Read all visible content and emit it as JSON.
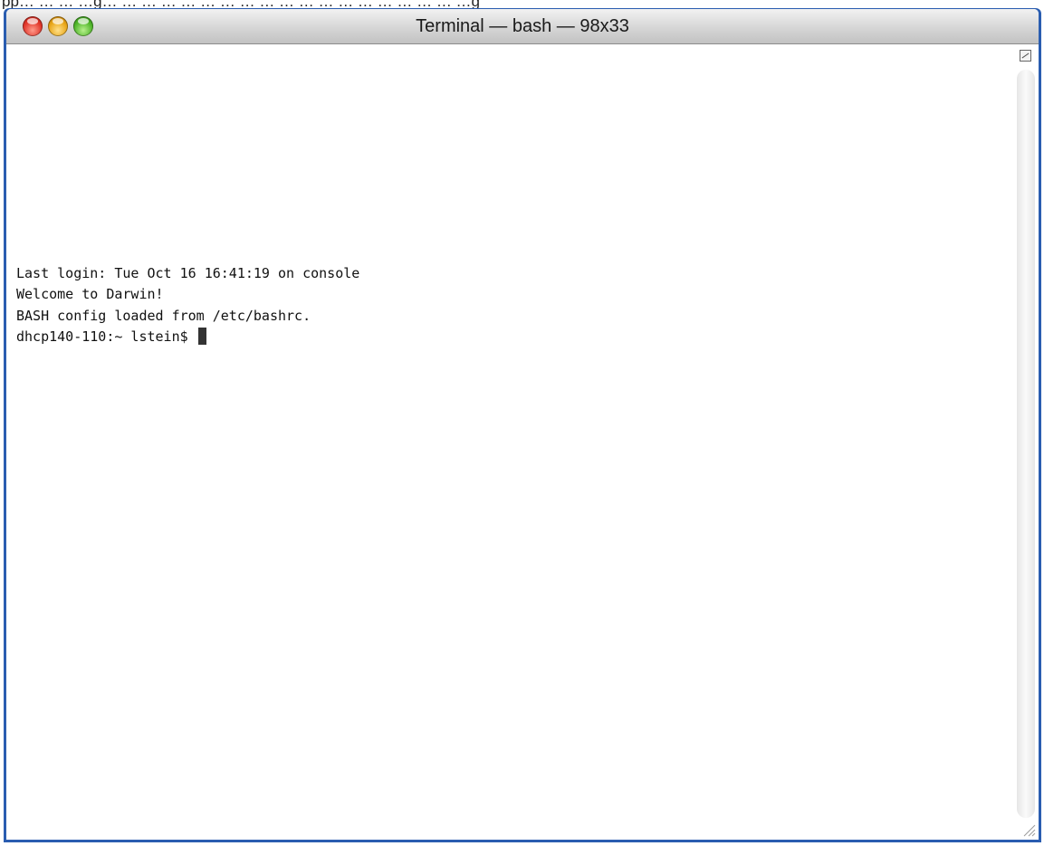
{
  "caption": "pp… … … …g… … … … … … … … … … … … … … … … … … …g",
  "window": {
    "title": "Terminal — bash — 98x33",
    "controls": {
      "close": "close-icon",
      "minimize": "minimize-icon",
      "zoom": "zoom-icon"
    }
  },
  "terminal": {
    "lines": [
      "Last login: Tue Oct 16 16:41:19 on console",
      "Welcome to Darwin!",
      "BASH config loaded from /etc/bashrc."
    ],
    "prompt": "dhcp140-110:~ lstein$ "
  },
  "colors": {
    "window_border": "#2a5db0",
    "titlebar": "#d6d6d6",
    "close": "#e0352a",
    "minimize": "#e8a516",
    "zoom": "#4fb52a"
  }
}
